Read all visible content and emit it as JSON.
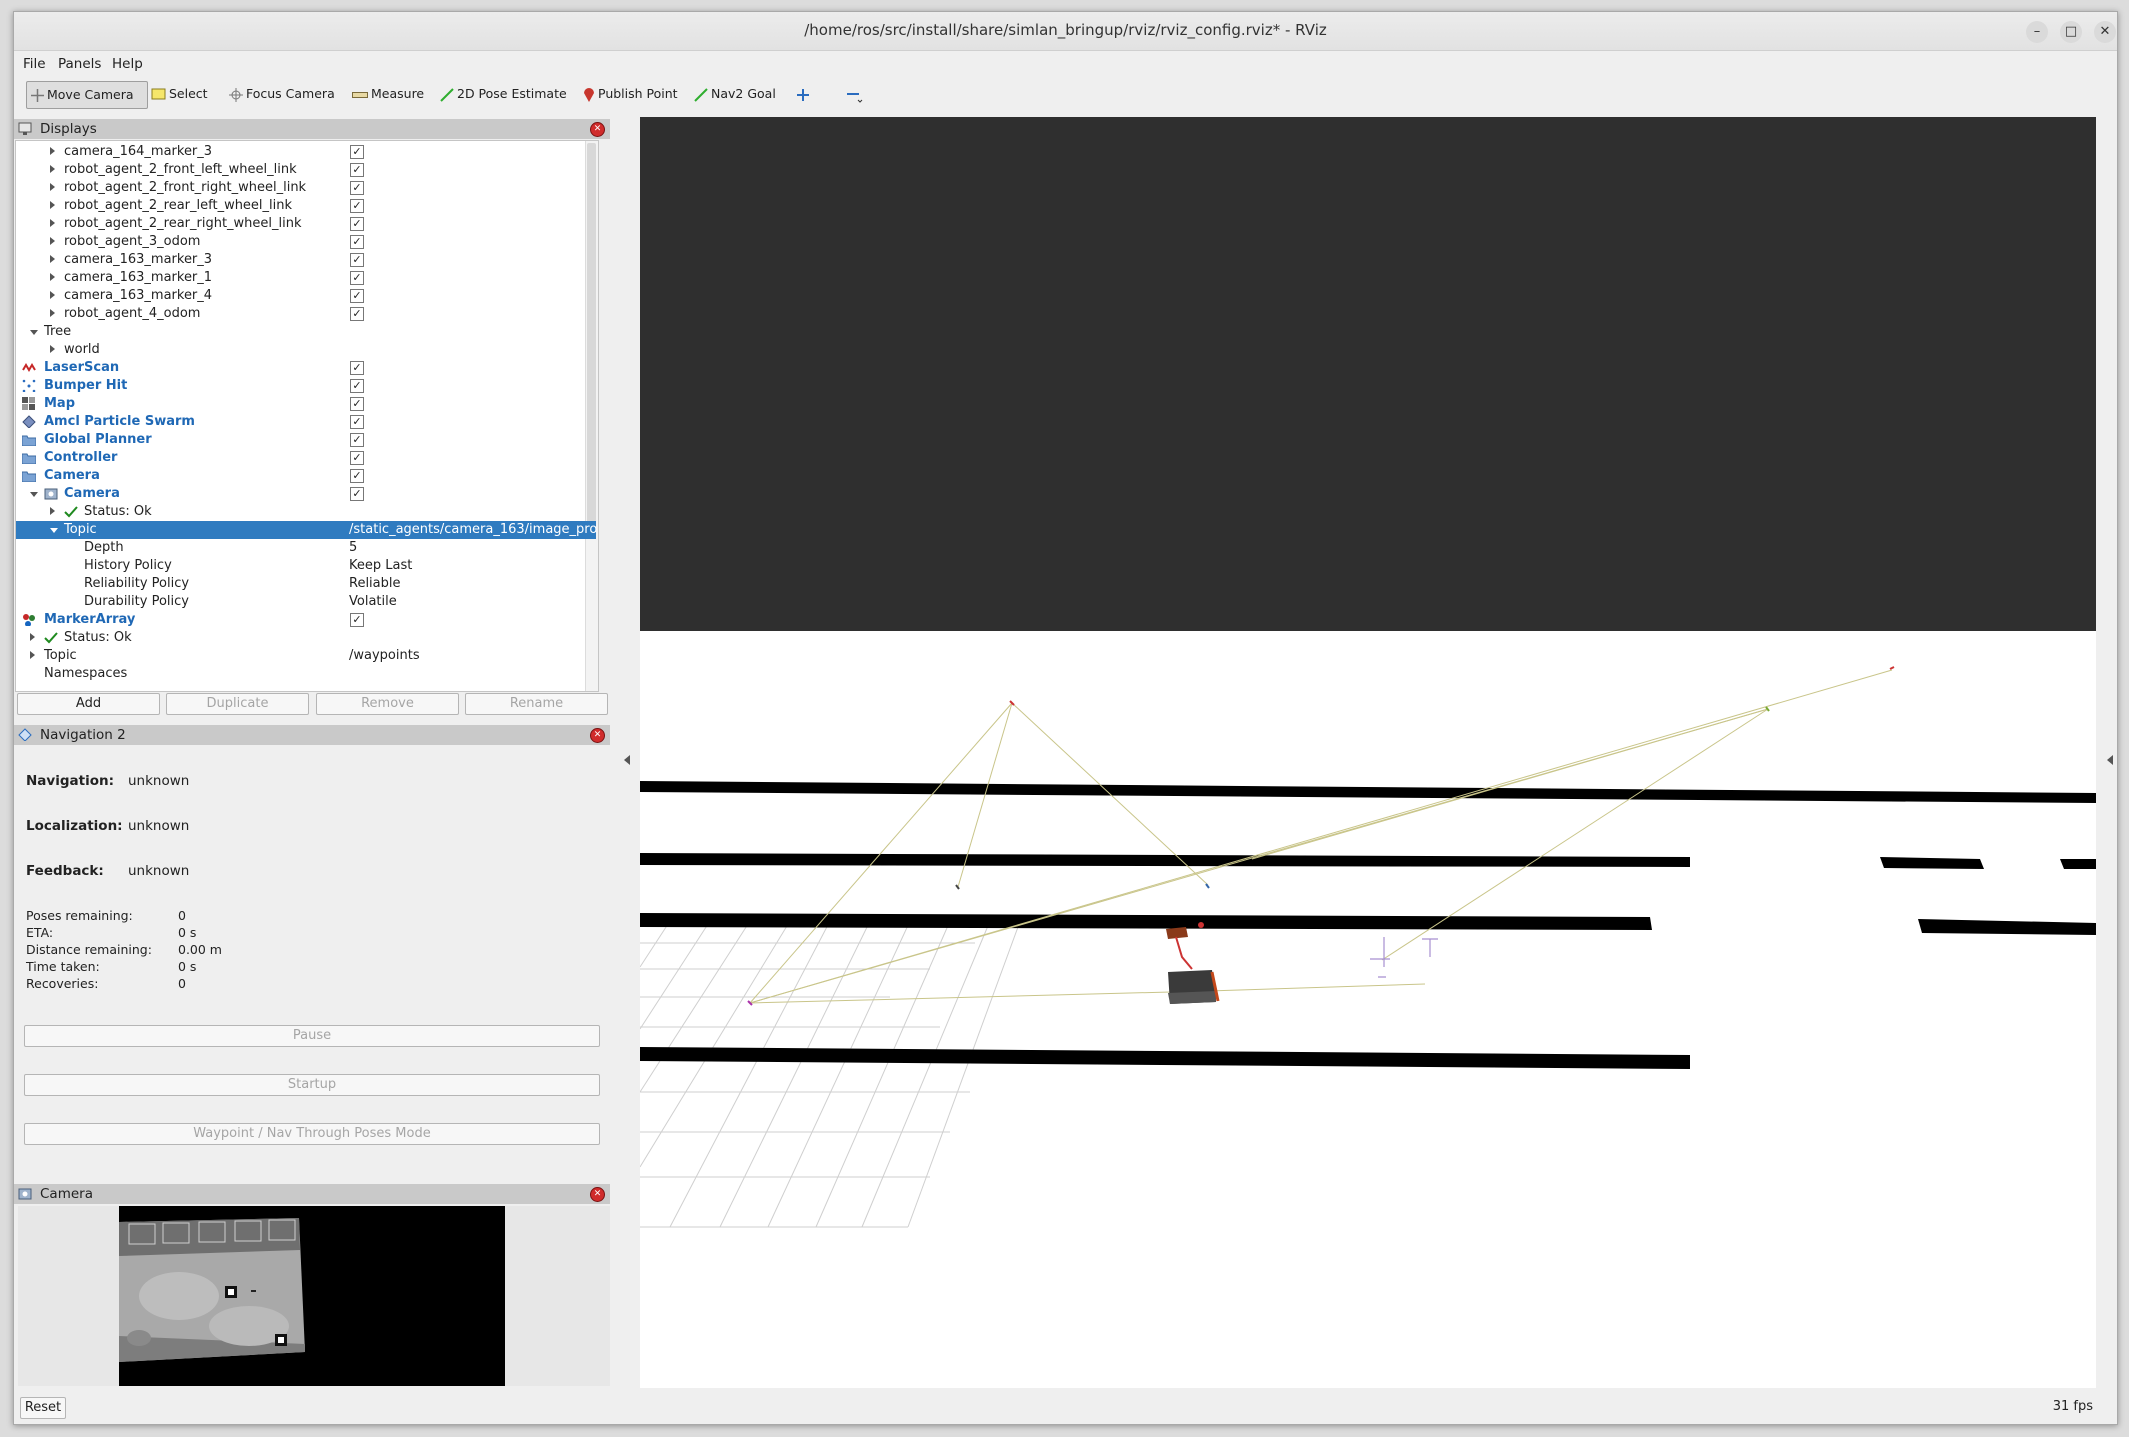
{
  "window": {
    "title": "/home/ros/src/install/share/simlan_bringup/rviz/rviz_config.rviz* - RViz",
    "buttons": {
      "minimize": "–",
      "maximize": "□",
      "close": "✕"
    }
  },
  "menu": [
    "File",
    "Panels",
    "Help"
  ],
  "toolbar": {
    "move_camera": "Move Camera",
    "select": "Select",
    "focus_camera": "Focus Camera",
    "measure": "Measure",
    "pose_estimate": "2D Pose Estimate",
    "publish_point": "Publish Point",
    "nav2_goal": "Nav2 Goal"
  },
  "displays": {
    "title": "Displays",
    "rows": [
      {
        "label": "camera_164_marker_3",
        "checked": true
      },
      {
        "label": "robot_agent_2_front_left_wheel_link",
        "checked": true
      },
      {
        "label": "robot_agent_2_front_right_wheel_link",
        "checked": true
      },
      {
        "label": "robot_agent_2_rear_left_wheel_link",
        "checked": true
      },
      {
        "label": "robot_agent_2_rear_right_wheel_link",
        "checked": true
      },
      {
        "label": "robot_agent_3_odom",
        "checked": true
      },
      {
        "label": "camera_163_marker_3",
        "checked": true
      },
      {
        "label": "camera_163_marker_1",
        "checked": true
      },
      {
        "label": "camera_163_marker_4",
        "checked": true
      },
      {
        "label": "robot_agent_4_odom",
        "checked": true
      },
      {
        "label": "Tree"
      },
      {
        "label": "world"
      },
      {
        "label": "LaserScan",
        "checked": true
      },
      {
        "label": "Bumper Hit",
        "checked": true
      },
      {
        "label": "Map",
        "checked": true
      },
      {
        "label": "Amcl Particle Swarm",
        "checked": true
      },
      {
        "label": "Global Planner",
        "checked": true
      },
      {
        "label": "Controller",
        "checked": true
      },
      {
        "label": "Camera",
        "checked": true
      },
      {
        "label": "Camera",
        "checked": true
      },
      {
        "label": "Status: Ok"
      },
      {
        "label": "Topic",
        "value": "/static_agents/camera_163/image_pro..."
      },
      {
        "label": "Depth",
        "value": "5"
      },
      {
        "label": "History Policy",
        "value": "Keep Last"
      },
      {
        "label": "Reliability Policy",
        "value": "Reliable"
      },
      {
        "label": "Durability Policy",
        "value": "Volatile"
      },
      {
        "label": "MarkerArray",
        "checked": true
      },
      {
        "label": "Status: Ok"
      },
      {
        "label": "Topic",
        "value": "/waypoints"
      },
      {
        "label": "Namespaces"
      }
    ],
    "buttons": {
      "add": "Add",
      "duplicate": "Duplicate",
      "remove": "Remove",
      "rename": "Rename"
    }
  },
  "navigation": {
    "title": "Navigation 2",
    "navigation_label": "Navigation:",
    "navigation_value": "unknown",
    "localization_label": "Localization:",
    "localization_value": "unknown",
    "feedback_label": "Feedback:",
    "feedback_value": "unknown",
    "stats": [
      {
        "label": "Poses remaining:",
        "value": "0"
      },
      {
        "label": "ETA:",
        "value": "0 s"
      },
      {
        "label": "Distance remaining:",
        "value": "0.00 m"
      },
      {
        "label": "Time taken:",
        "value": "0 s"
      },
      {
        "label": "Recoveries:",
        "value": "0"
      }
    ],
    "pause": "Pause",
    "startup": "Startup",
    "waypoint_mode": "Waypoint / Nav Through Poses Mode"
  },
  "camera_panel": {
    "title": "Camera"
  },
  "status": {
    "reset": "Reset",
    "fps": "31 fps"
  },
  "colors": {
    "selection": "#2f7bc0",
    "link_blue": "#1f68b5",
    "viewport_sky": "#2f2f2f",
    "obstacle": "#000000"
  }
}
